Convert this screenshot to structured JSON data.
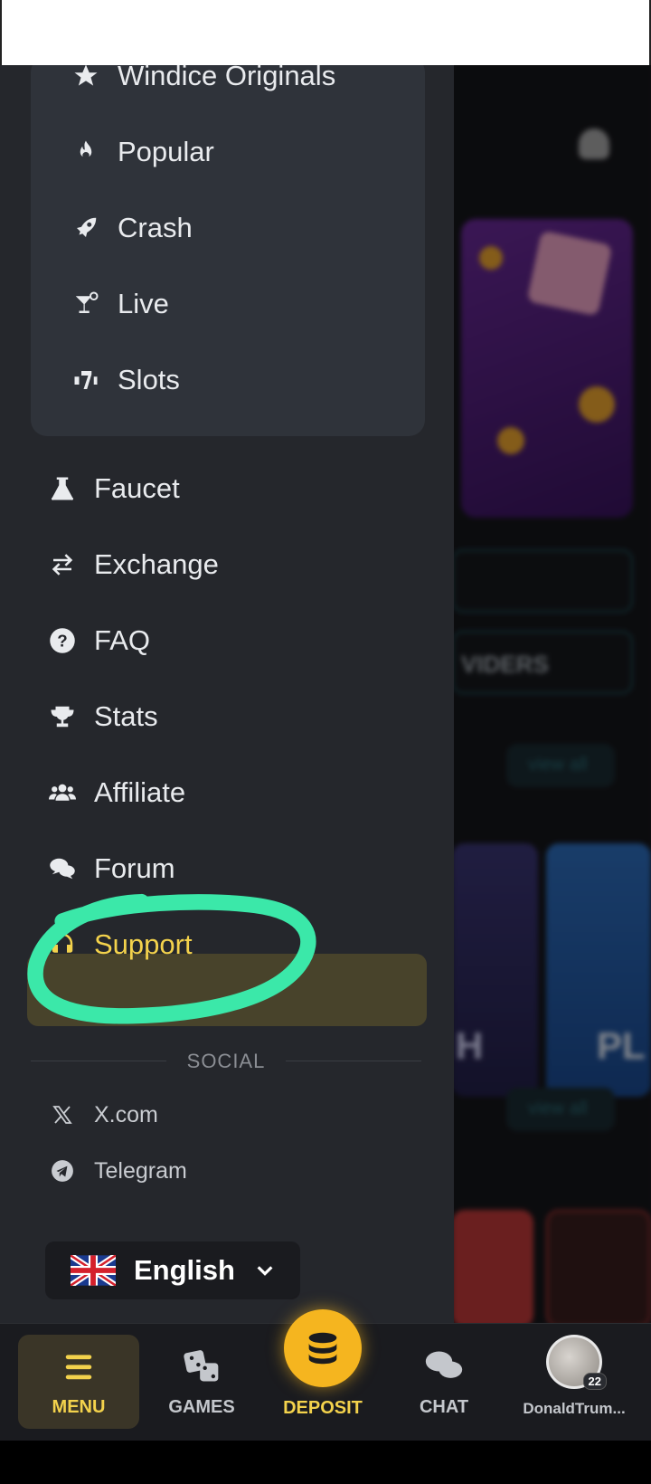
{
  "games_group": [
    {
      "label": "Windice Originals",
      "icon": "star-icon"
    },
    {
      "label": "Popular",
      "icon": "fire-icon"
    },
    {
      "label": "Crash",
      "icon": "rocket-icon"
    },
    {
      "label": "Live",
      "icon": "cocktail-icon"
    },
    {
      "label": "Slots",
      "icon": "slots-icon"
    }
  ],
  "menu": [
    {
      "label": "Faucet",
      "icon": "flask-icon"
    },
    {
      "label": "Exchange",
      "icon": "exchange-icon"
    },
    {
      "label": "FAQ",
      "icon": "question-icon"
    },
    {
      "label": "Stats",
      "icon": "trophy-icon"
    },
    {
      "label": "Affiliate",
      "icon": "users-icon"
    },
    {
      "label": "Forum",
      "icon": "comments-icon"
    },
    {
      "label": "Support",
      "icon": "headset-icon",
      "active": true
    }
  ],
  "social": {
    "heading": "SOCIAL",
    "items": [
      {
        "label": "X.com",
        "icon": "x-icon"
      },
      {
        "label": "Telegram",
        "icon": "telegram-icon"
      }
    ]
  },
  "language": {
    "label": "English",
    "flag": "uk-flag-icon"
  },
  "background": {
    "providers_fragment": "VIDERS",
    "view_all": "view all",
    "tile_text_1": "H",
    "tile_text_2": "PL"
  },
  "bottom_nav": {
    "menu": "MENU",
    "games": "GAMES",
    "deposit": "DEPOSIT",
    "chat": "CHAT",
    "user": "DonaldTrum...",
    "badge": "22"
  },
  "colors": {
    "accent": "#f3d24c",
    "highlight": "#3be8a9",
    "drawer": "#25272c"
  }
}
